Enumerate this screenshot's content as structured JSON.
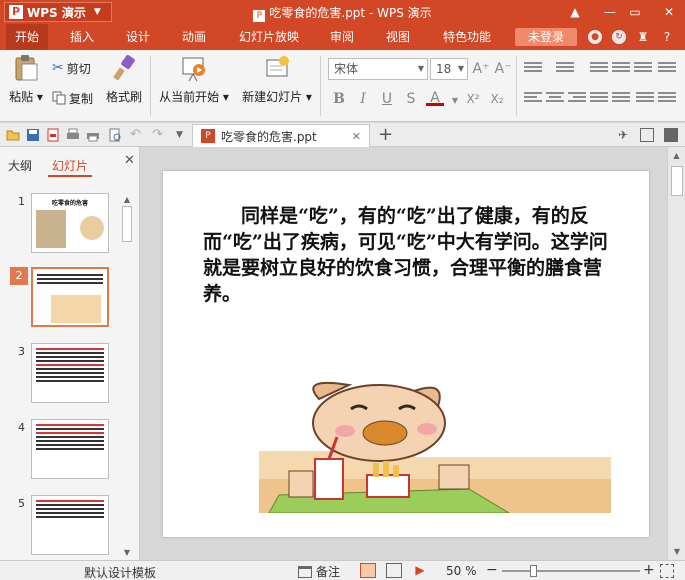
{
  "window": {
    "app_name": "WPS 演示",
    "title": "吃零食的危害.ppt - WPS 演示"
  },
  "menu": {
    "items": [
      "开始",
      "插入",
      "设计",
      "动画",
      "幻灯片放映",
      "审阅",
      "视图",
      "特色功能"
    ],
    "active": 0,
    "login": "未登录"
  },
  "ribbon": {
    "paste": "粘贴",
    "cut": "剪切",
    "copy": "复制",
    "format_painter": "格式刷",
    "from_current": "从当前开始",
    "new_slide": "新建幻灯片",
    "font_name": "宋体",
    "font_size": "18"
  },
  "tabs": {
    "document": "吃零食的危害.ppt"
  },
  "left_pane": {
    "tab_outline": "大纲",
    "tab_slides": "幻灯片",
    "selected": 2,
    "thumbnails": [
      {
        "num": "1",
        "title": "吃零食的危害"
      },
      {
        "num": "2"
      },
      {
        "num": "3"
      },
      {
        "num": "4"
      },
      {
        "num": "5"
      }
    ]
  },
  "slide": {
    "text": "同样是“吃”，有的“吃”出了健康，有的反而“吃”出了疾病，可见“吃”中大有学问。这学问就是要树立良好的饮食习惯，合理平衡的膳食营养。"
  },
  "status": {
    "template": "默认设计模板",
    "notes": "备注",
    "zoom": "50 %"
  },
  "colors": {
    "accent": "#d24726",
    "selection": "#e07a4a"
  }
}
